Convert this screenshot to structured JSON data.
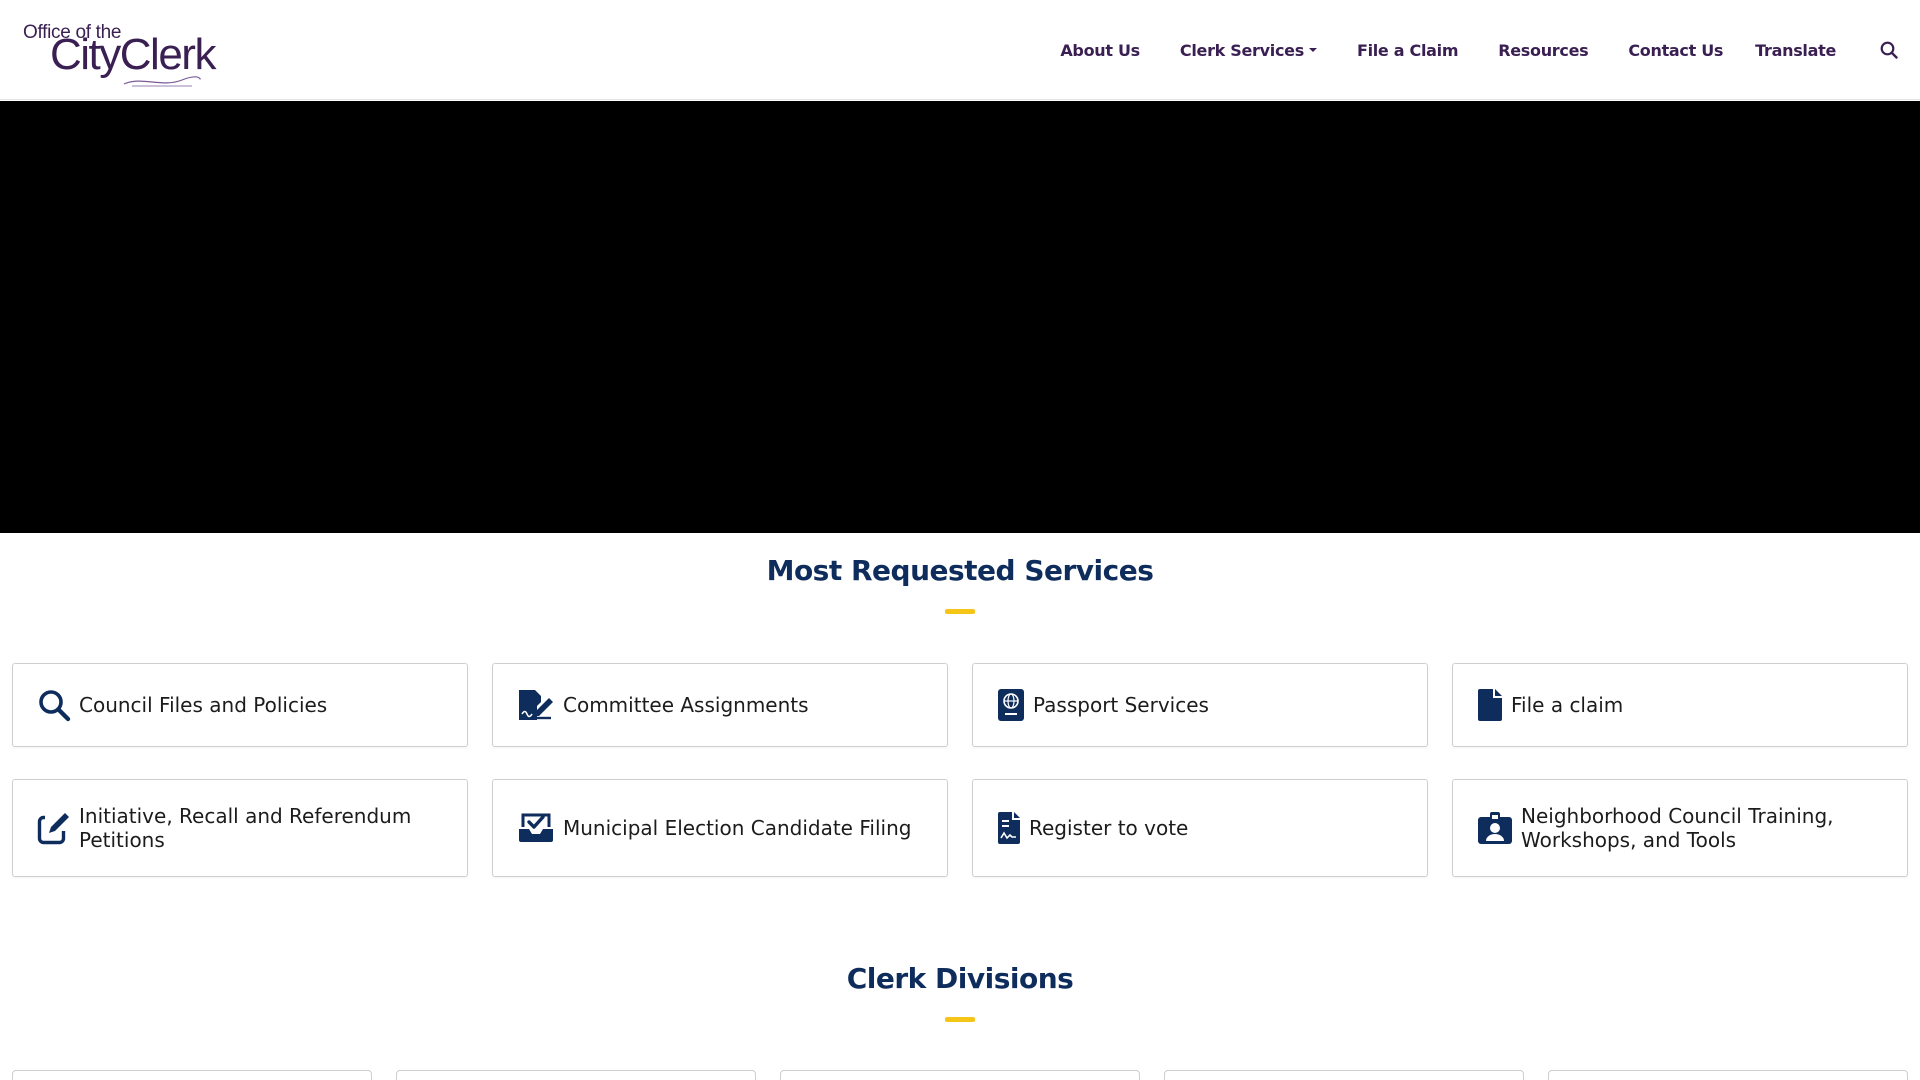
{
  "header": {
    "logo": {
      "line1": "Office of the",
      "line2": "CityClerk"
    },
    "nav": [
      {
        "label": "About Us"
      },
      {
        "label": "Clerk Services"
      },
      {
        "label": "File a Claim"
      },
      {
        "label": "Resources"
      },
      {
        "label": "Contact Us"
      },
      {
        "label": "Translate"
      }
    ],
    "search_icon": "search-icon"
  },
  "sections": {
    "most_requested": {
      "title": "Most Requested Services",
      "items": [
        {
          "label": "Council Files and Policies",
          "icon": "search-icon"
        },
        {
          "label": "Committee Assignments",
          "icon": "file-signature-icon"
        },
        {
          "label": "Passport Services",
          "icon": "passport-icon"
        },
        {
          "label": "File a claim",
          "icon": "file-icon"
        },
        {
          "label": "Initiative, Recall and Referendum Petitions",
          "icon": "edit-icon"
        },
        {
          "label": "Municipal Election Candidate Filing",
          "icon": "inbox-check-icon"
        },
        {
          "label": "Register to vote",
          "icon": "file-contract-icon"
        },
        {
          "label": "Neighborhood Council Training, Workshops, and Tools",
          "icon": "id-badge-icon"
        }
      ]
    },
    "divisions": {
      "title": "Clerk Divisions"
    }
  },
  "colors": {
    "brand_purple": "#3a1f52",
    "title_navy": "#0f2d5c",
    "accent_yellow": "#f5c518",
    "icon_navy": "#0f2d5c"
  }
}
